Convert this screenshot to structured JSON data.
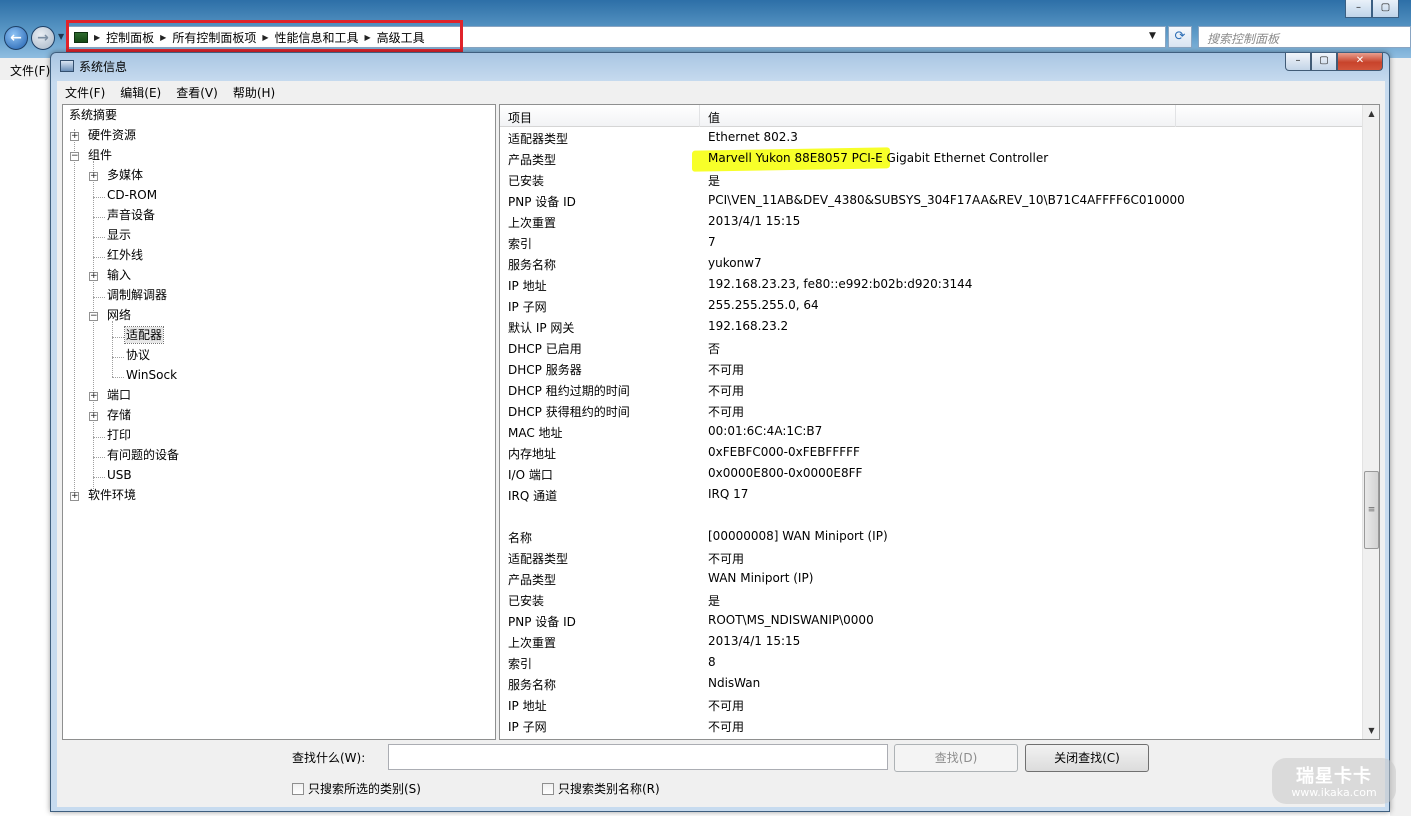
{
  "explorer": {
    "breadcrumbs": [
      "控制面板",
      "所有控制面板项",
      "性能信息和工具",
      "高级工具"
    ],
    "search_placeholder": "搜索控制面板",
    "menu_file": "文件(F)"
  },
  "window": {
    "title": "系统信息",
    "caption_minimize": "–",
    "caption_maximize": "▢",
    "caption_close": "✕"
  },
  "menu": [
    "文件(F)",
    "编辑(E)",
    "查看(V)",
    "帮助(H)"
  ],
  "tree": {
    "summary": "系统摘要",
    "hardware": "硬件资源",
    "components": "组件",
    "multimedia": "多媒体",
    "cdrom": "CD-ROM",
    "sound": "声音设备",
    "display": "显示",
    "infrared": "红外线",
    "input": "输入",
    "modem": "调制解调器",
    "network": "网络",
    "adapter": "适配器",
    "protocol": "协议",
    "winsock": "WinSock",
    "ports": "端口",
    "storage": "存储",
    "printing": "打印",
    "problem_devices": "有问题的设备",
    "usb": "USB",
    "software_env": "软件环境"
  },
  "list": {
    "columns": [
      "项目",
      "值"
    ],
    "rows": [
      {
        "item": "适配器类型",
        "value": "Ethernet 802.3"
      },
      {
        "item": "产品类型",
        "value": "Marvell Yukon 88E8057 PCI-E Gigabit Ethernet Controller"
      },
      {
        "item": "已安装",
        "value": "是"
      },
      {
        "item": "PNP 设备 ID",
        "value": "PCI\\VEN_11AB&DEV_4380&SUBSYS_304F17AA&REV_10\\B71C4AFFFF6C010000"
      },
      {
        "item": "上次重置",
        "value": "2013/4/1 15:15"
      },
      {
        "item": "索引",
        "value": "7"
      },
      {
        "item": "服务名称",
        "value": "yukonw7"
      },
      {
        "item": "IP 地址",
        "value": "192.168.23.23, fe80::e992:b02b:d920:3144"
      },
      {
        "item": "IP 子网",
        "value": "255.255.255.0, 64"
      },
      {
        "item": "默认 IP 网关",
        "value": "192.168.23.2"
      },
      {
        "item": "DHCP 已启用",
        "value": "否"
      },
      {
        "item": "DHCP 服务器",
        "value": "不可用"
      },
      {
        "item": "DHCP 租约过期的时间",
        "value": "不可用"
      },
      {
        "item": "DHCP 获得租约的时间",
        "value": "不可用"
      },
      {
        "item": "MAC 地址",
        "value": "00:01:6C:4A:1C:B7"
      },
      {
        "item": "内存地址",
        "value": "0xFEBFC000-0xFEBFFFFF"
      },
      {
        "item": "I/O 端口",
        "value": "0x0000E800-0x0000E8FF"
      },
      {
        "item": "IRQ 通道",
        "value": "IRQ 17"
      },
      {
        "item": "",
        "value": ""
      },
      {
        "item": "名称",
        "value": "[00000008] WAN Miniport (IP)"
      },
      {
        "item": "适配器类型",
        "value": "不可用"
      },
      {
        "item": "产品类型",
        "value": "WAN Miniport (IP)"
      },
      {
        "item": "已安装",
        "value": "是"
      },
      {
        "item": "PNP 设备 ID",
        "value": "ROOT\\MS_NDISWANIP\\0000"
      },
      {
        "item": "上次重置",
        "value": "2013/4/1 15:15"
      },
      {
        "item": "索引",
        "value": "8"
      },
      {
        "item": "服务名称",
        "value": "NdisWan"
      },
      {
        "item": "IP 地址",
        "value": "不可用"
      },
      {
        "item": "IP 子网",
        "value": "不可用"
      }
    ]
  },
  "find": {
    "label": "查找什么(W):",
    "input_value": "",
    "find_button": "查找(D)",
    "close_find_button": "关闭查找(C)",
    "search_selected_category": "只搜索所选的类别(S)",
    "search_category_names": "只搜索类别名称(R)"
  },
  "watermark": {
    "brand": "瑞星卡卡",
    "url": "www.ikaka.com"
  },
  "colors": {
    "red_highlight": "#e0232b",
    "yellow_marker": "#f7ff1e"
  }
}
